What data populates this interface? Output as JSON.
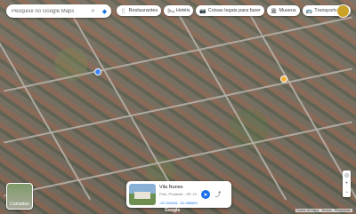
{
  "search": {
    "placeholder": "Pesquise no Google Maps"
  },
  "chips": [
    {
      "icon": "restaurant-icon",
      "glyph": "🍴",
      "label": "Restaurantes"
    },
    {
      "icon": "hotel-icon",
      "glyph": "🛏",
      "label": "Hotéis"
    },
    {
      "icon": "attractions-icon",
      "glyph": "📷",
      "label": "Coisas legais para fazer"
    },
    {
      "icon": "museum-icon",
      "glyph": "🏛",
      "label": "Museus"
    },
    {
      "icon": "transit-icon",
      "glyph": "🚌",
      "label": "Transporte púb"
    }
  ],
  "layers": {
    "label": "Camadas"
  },
  "place_card": {
    "title": "Vila Nunes",
    "address": "Pres. Prudente - SP, 19...",
    "coords": "-22.105443, -51.385563"
  },
  "footer": {
    "items": [
      "Dados do mapa",
      "Termos",
      "Privacidade"
    ]
  },
  "brand": "Google",
  "colors": {
    "accent": "#1a73e8",
    "avatar": "#c9a227",
    "pin": "#f2b134"
  }
}
